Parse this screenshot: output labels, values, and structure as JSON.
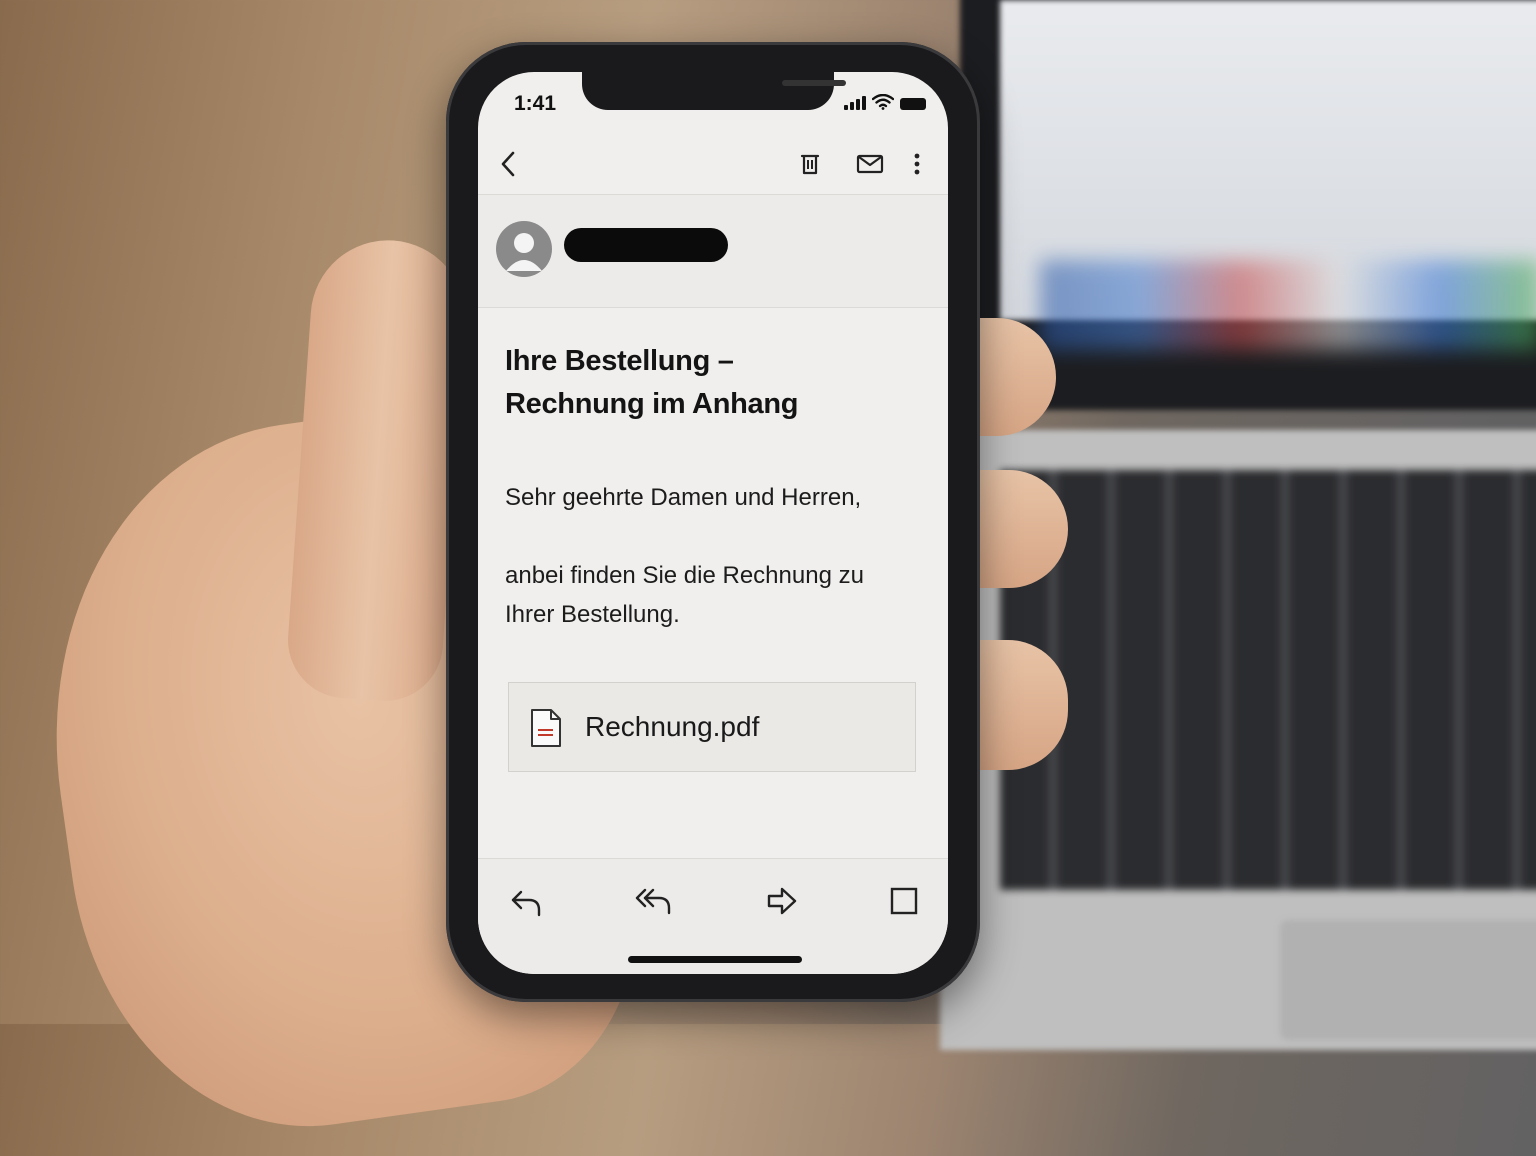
{
  "status_bar": {
    "time": "1:41",
    "icons": [
      "cellular-signal-icon",
      "wifi-icon",
      "battery-icon"
    ]
  },
  "toolbar": {
    "icons": [
      "back-arrow-icon",
      "trash-icon",
      "envelope-icon",
      "more-vertical-icon"
    ]
  },
  "email": {
    "subject_lines": [
      "Ihre Bestellung –",
      "Rechnung im Anhang"
    ],
    "greeting": "Sehr geehrte Damen und Herren,",
    "body_lines": [
      "anbei finden Sie die Rechnung zu",
      "Ihrer Bestellung."
    ],
    "attachment": {
      "name": "Rechnung.pdf",
      "icon": "pdf-file-icon"
    }
  },
  "bottom_bar": {
    "icons": [
      "reply-icon",
      "reply-all-icon",
      "forward-icon",
      "checkbox-icon"
    ]
  },
  "colors": {
    "screen_background": "#f0efed",
    "text": "#141414",
    "pdf_accent": "#c0392b"
  }
}
